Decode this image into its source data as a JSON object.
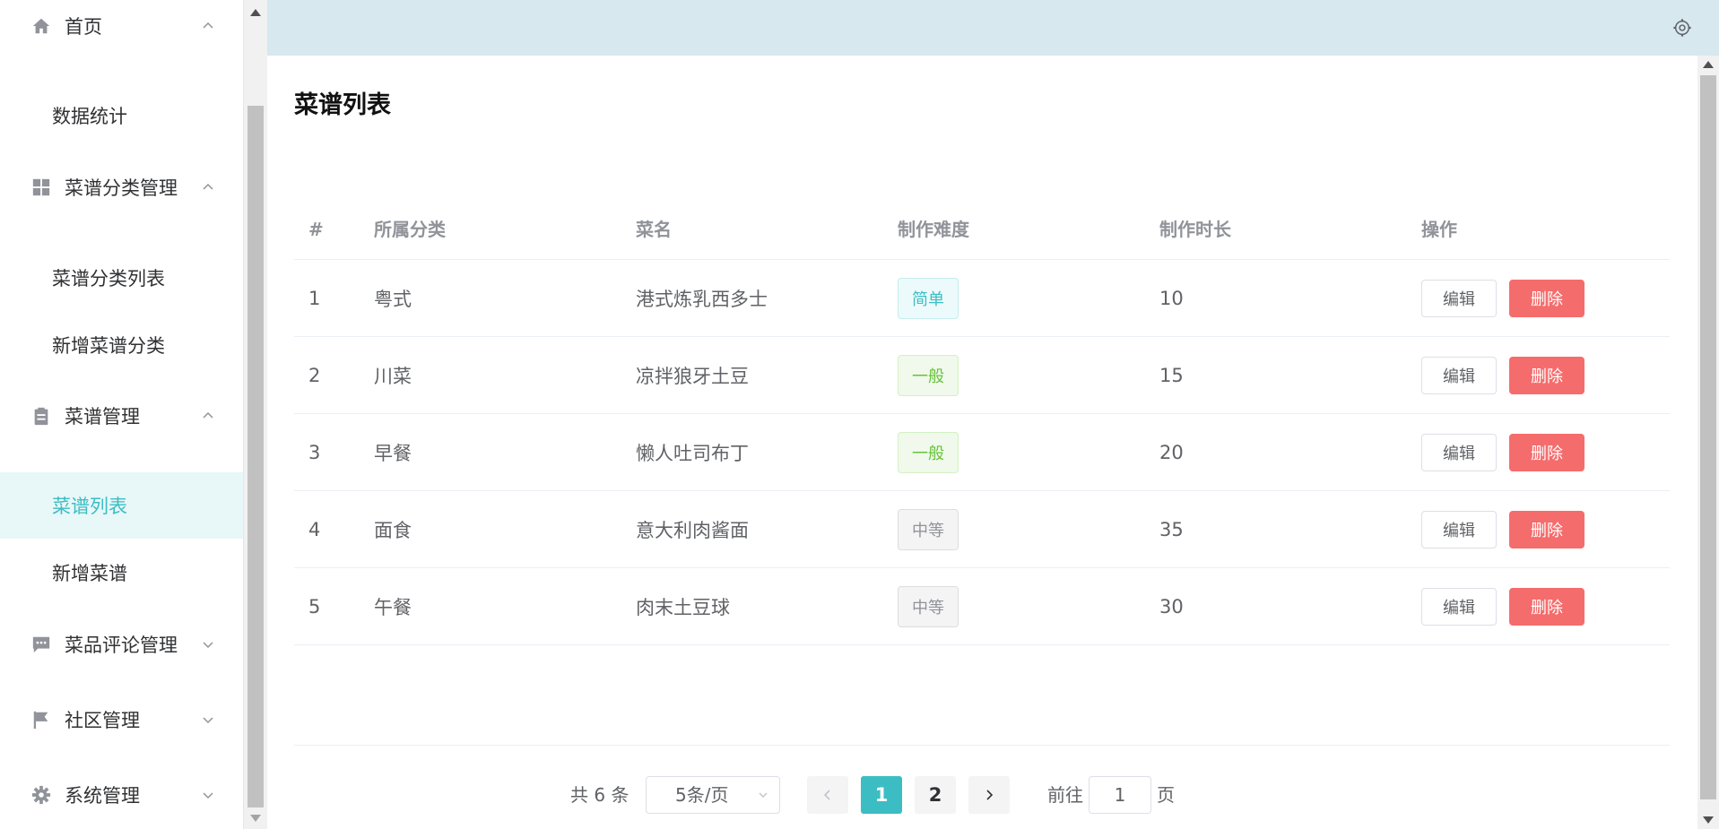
{
  "sidebar": {
    "home": {
      "label": "首页",
      "icon": "home-icon"
    },
    "stats": {
      "label": "数据统计"
    },
    "category_mgmt": {
      "label": "菜谱分类管理",
      "icon": "grid-icon"
    },
    "category_list": {
      "label": "菜谱分类列表"
    },
    "category_add": {
      "label": "新增菜谱分类"
    },
    "recipe_mgmt": {
      "label": "菜谱管理",
      "icon": "clipboard-icon"
    },
    "recipe_list": {
      "label": "菜谱列表"
    },
    "recipe_add": {
      "label": "新增菜谱"
    },
    "comment_mgmt": {
      "label": "菜品评论管理",
      "icon": "comment-icon"
    },
    "community_mgmt": {
      "label": "社区管理",
      "icon": "flag-icon"
    },
    "system_mgmt": {
      "label": "系统管理",
      "icon": "gear-icon"
    }
  },
  "page_title": "菜谱列表",
  "table": {
    "columns": [
      "#",
      "所属分类",
      "菜名",
      "制作难度",
      "制作时长",
      "操作"
    ],
    "rows": [
      {
        "index": "1",
        "category": "粤式",
        "name": "港式炼乳西多士",
        "difficulty": "简单",
        "difficulty_level": "easy",
        "duration": "10"
      },
      {
        "index": "2",
        "category": "川菜",
        "name": "凉拌狼牙土豆",
        "difficulty": "一般",
        "difficulty_level": "mid",
        "duration": "15"
      },
      {
        "index": "3",
        "category": "早餐",
        "name": "懒人吐司布丁",
        "difficulty": "一般",
        "difficulty_level": "mid",
        "duration": "20"
      },
      {
        "index": "4",
        "category": "面食",
        "name": "意大利肉酱面",
        "difficulty": "中等",
        "difficulty_level": "hard",
        "duration": "35"
      },
      {
        "index": "5",
        "category": "午餐",
        "name": "肉末土豆球",
        "difficulty": "中等",
        "difficulty_level": "hard",
        "duration": "30"
      }
    ],
    "edit_label": "编辑",
    "delete_label": "删除"
  },
  "pagination": {
    "total": "共 6 条",
    "page_size": "5条/页",
    "pages": [
      "1",
      "2"
    ],
    "current": "1",
    "goto_label": "前往",
    "goto_value": "1",
    "page_suffix": "页"
  },
  "colors": {
    "accent": "#3cbdc3",
    "danger": "#f56c6c",
    "header_bg": "#d7e8ef"
  }
}
